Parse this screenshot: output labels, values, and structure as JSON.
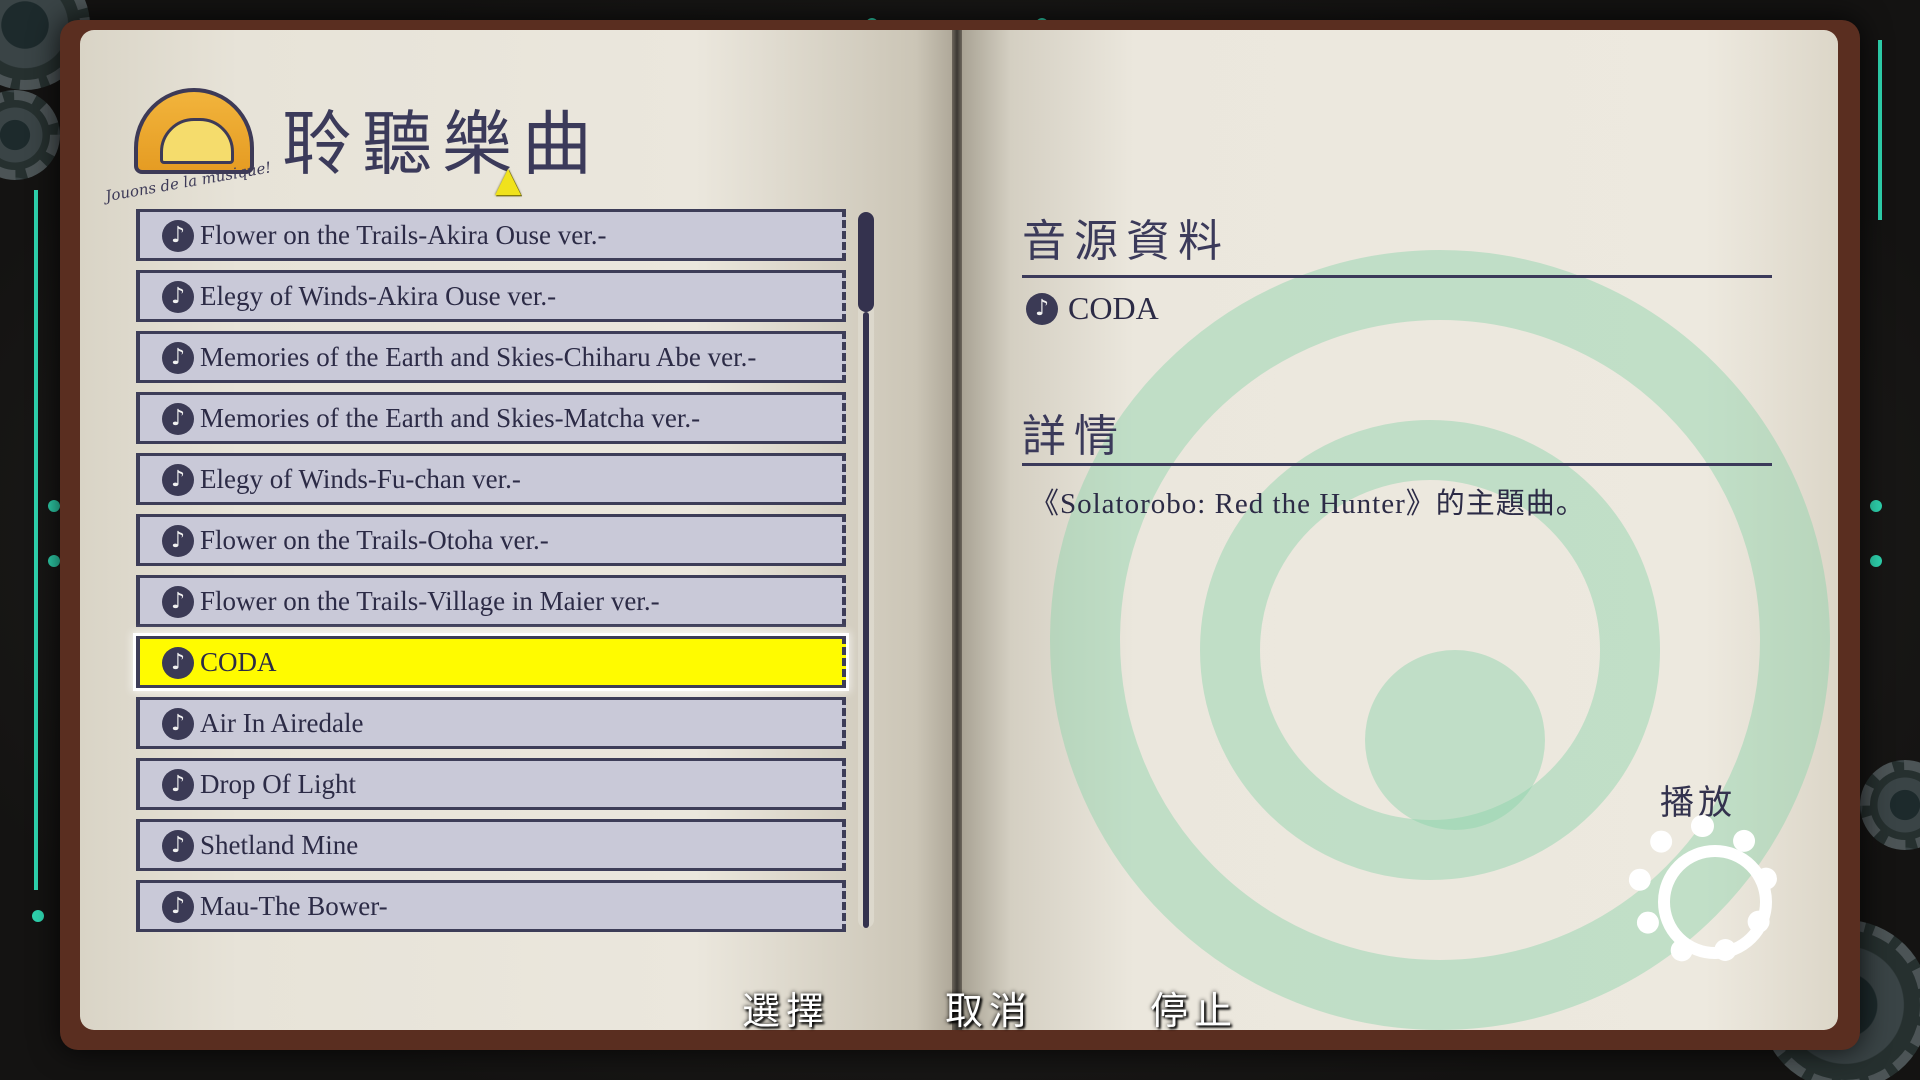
{
  "header": {
    "title": "聆聽樂曲",
    "logo_script": "Jouons de la musique!"
  },
  "songs": [
    {
      "label": "Flower on the Trails-Akira Ouse ver.-",
      "selected": false
    },
    {
      "label": "Elegy of Winds-Akira Ouse ver.-",
      "selected": false
    },
    {
      "label": "Memories of the Earth and Skies-Chiharu Abe ver.-",
      "selected": false
    },
    {
      "label": "Memories of the Earth and Skies-Matcha ver.-",
      "selected": false
    },
    {
      "label": "Elegy of Winds-Fu-chan ver.-",
      "selected": false
    },
    {
      "label": "Flower on the Trails-Otoha ver.-",
      "selected": false
    },
    {
      "label": "Flower on the Trails-Village in Maier ver.-",
      "selected": false
    },
    {
      "label": "CODA",
      "selected": true
    },
    {
      "label": "Air In Airedale",
      "selected": false
    },
    {
      "label": "Drop Of Light",
      "selected": false
    },
    {
      "label": "Shetland Mine",
      "selected": false
    },
    {
      "label": "Mau-The Bower-",
      "selected": false
    }
  ],
  "icons": {
    "song": "music-disc-icon",
    "cursor": "up-arrow-cursor-icon",
    "play": "gear-icon"
  },
  "source_section": {
    "title": "音源資料",
    "value": "CODA"
  },
  "detail_section": {
    "title": "詳情",
    "text": "《Solatorobo: Red the Hunter》的主題曲。"
  },
  "play": {
    "label": "播放"
  },
  "hints": {
    "select": "選擇",
    "cancel": "取消",
    "stop": "停止"
  },
  "colors": {
    "selected_row": "#fffb00",
    "row": "#c9c9d8",
    "ink": "#3b3a5a",
    "accent": "#2fd6b0"
  }
}
